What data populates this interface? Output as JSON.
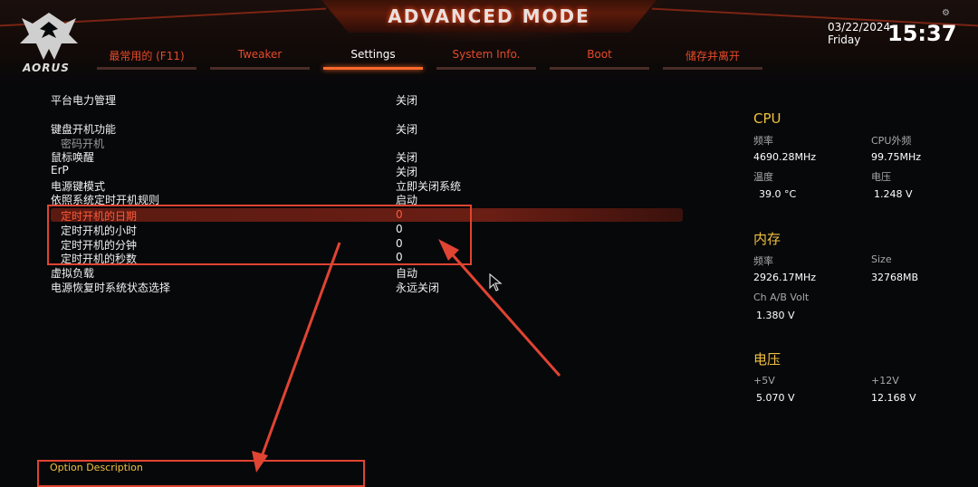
{
  "header": {
    "title": "ADVANCED MODE",
    "logo_text": "AORUS",
    "date": "03/22/2024",
    "day": "Friday",
    "time": "15:37"
  },
  "tabs": [
    {
      "label": "最常用的 (F11)"
    },
    {
      "label": "Tweaker"
    },
    {
      "label": "Settings"
    },
    {
      "label": "System Info."
    },
    {
      "label": "Boot"
    },
    {
      "label": "储存并离开"
    }
  ],
  "settings": {
    "rows": [
      {
        "label": "平台电力管理",
        "value": "关闭"
      },
      {
        "label": "键盘开机功能",
        "value": "关闭"
      },
      {
        "label": "密码开机",
        "value": ""
      },
      {
        "label": "鼠标唤醒",
        "value": "关闭"
      },
      {
        "label": "ErP",
        "value": "关闭"
      },
      {
        "label": "电源键模式",
        "value": "立即关闭系统"
      },
      {
        "label": "依照系统定时开机规则",
        "value": "启动"
      },
      {
        "label": "定时开机的日期",
        "value": "0"
      },
      {
        "label": "定时开机的小时",
        "value": "0"
      },
      {
        "label": "定时开机的分钟",
        "value": "0"
      },
      {
        "label": "定时开机的秒数",
        "value": "0"
      },
      {
        "label": "虚拟负载",
        "value": "自动"
      },
      {
        "label": "电源恢复时系统状态选择",
        "value": "永远关闭"
      }
    ]
  },
  "side_panel": {
    "cpu": {
      "title": "CPU",
      "freq_label": "频率",
      "freq_value": "4690.28MHz",
      "bclk_label": "CPU外频",
      "bclk_value": "99.75MHz",
      "temp_label": "温度",
      "temp_value": "39.0 °C",
      "volt_label": "电压",
      "volt_value": "1.248 V"
    },
    "memory": {
      "title": "内存",
      "freq_label": "频率",
      "freq_value": "2926.17MHz",
      "size_label": "Size",
      "size_value": "32768MB",
      "volt_label": "Ch A/B Volt",
      "volt_value": "1.380 V"
    },
    "voltage": {
      "title": "电压",
      "p5_label": "+5V",
      "p5_value": "5.070 V",
      "p12_label": "+12V",
      "p12_value": "12.168 V"
    }
  },
  "bottom": {
    "option_description_label": "Option Description"
  },
  "colors": {
    "accent_orange": "#ff6a2a",
    "tab_red": "#e44b2a",
    "highlight_value": "#ff5a3a",
    "panel_heading": "#f0c040",
    "annotation_red": "#e04432"
  }
}
